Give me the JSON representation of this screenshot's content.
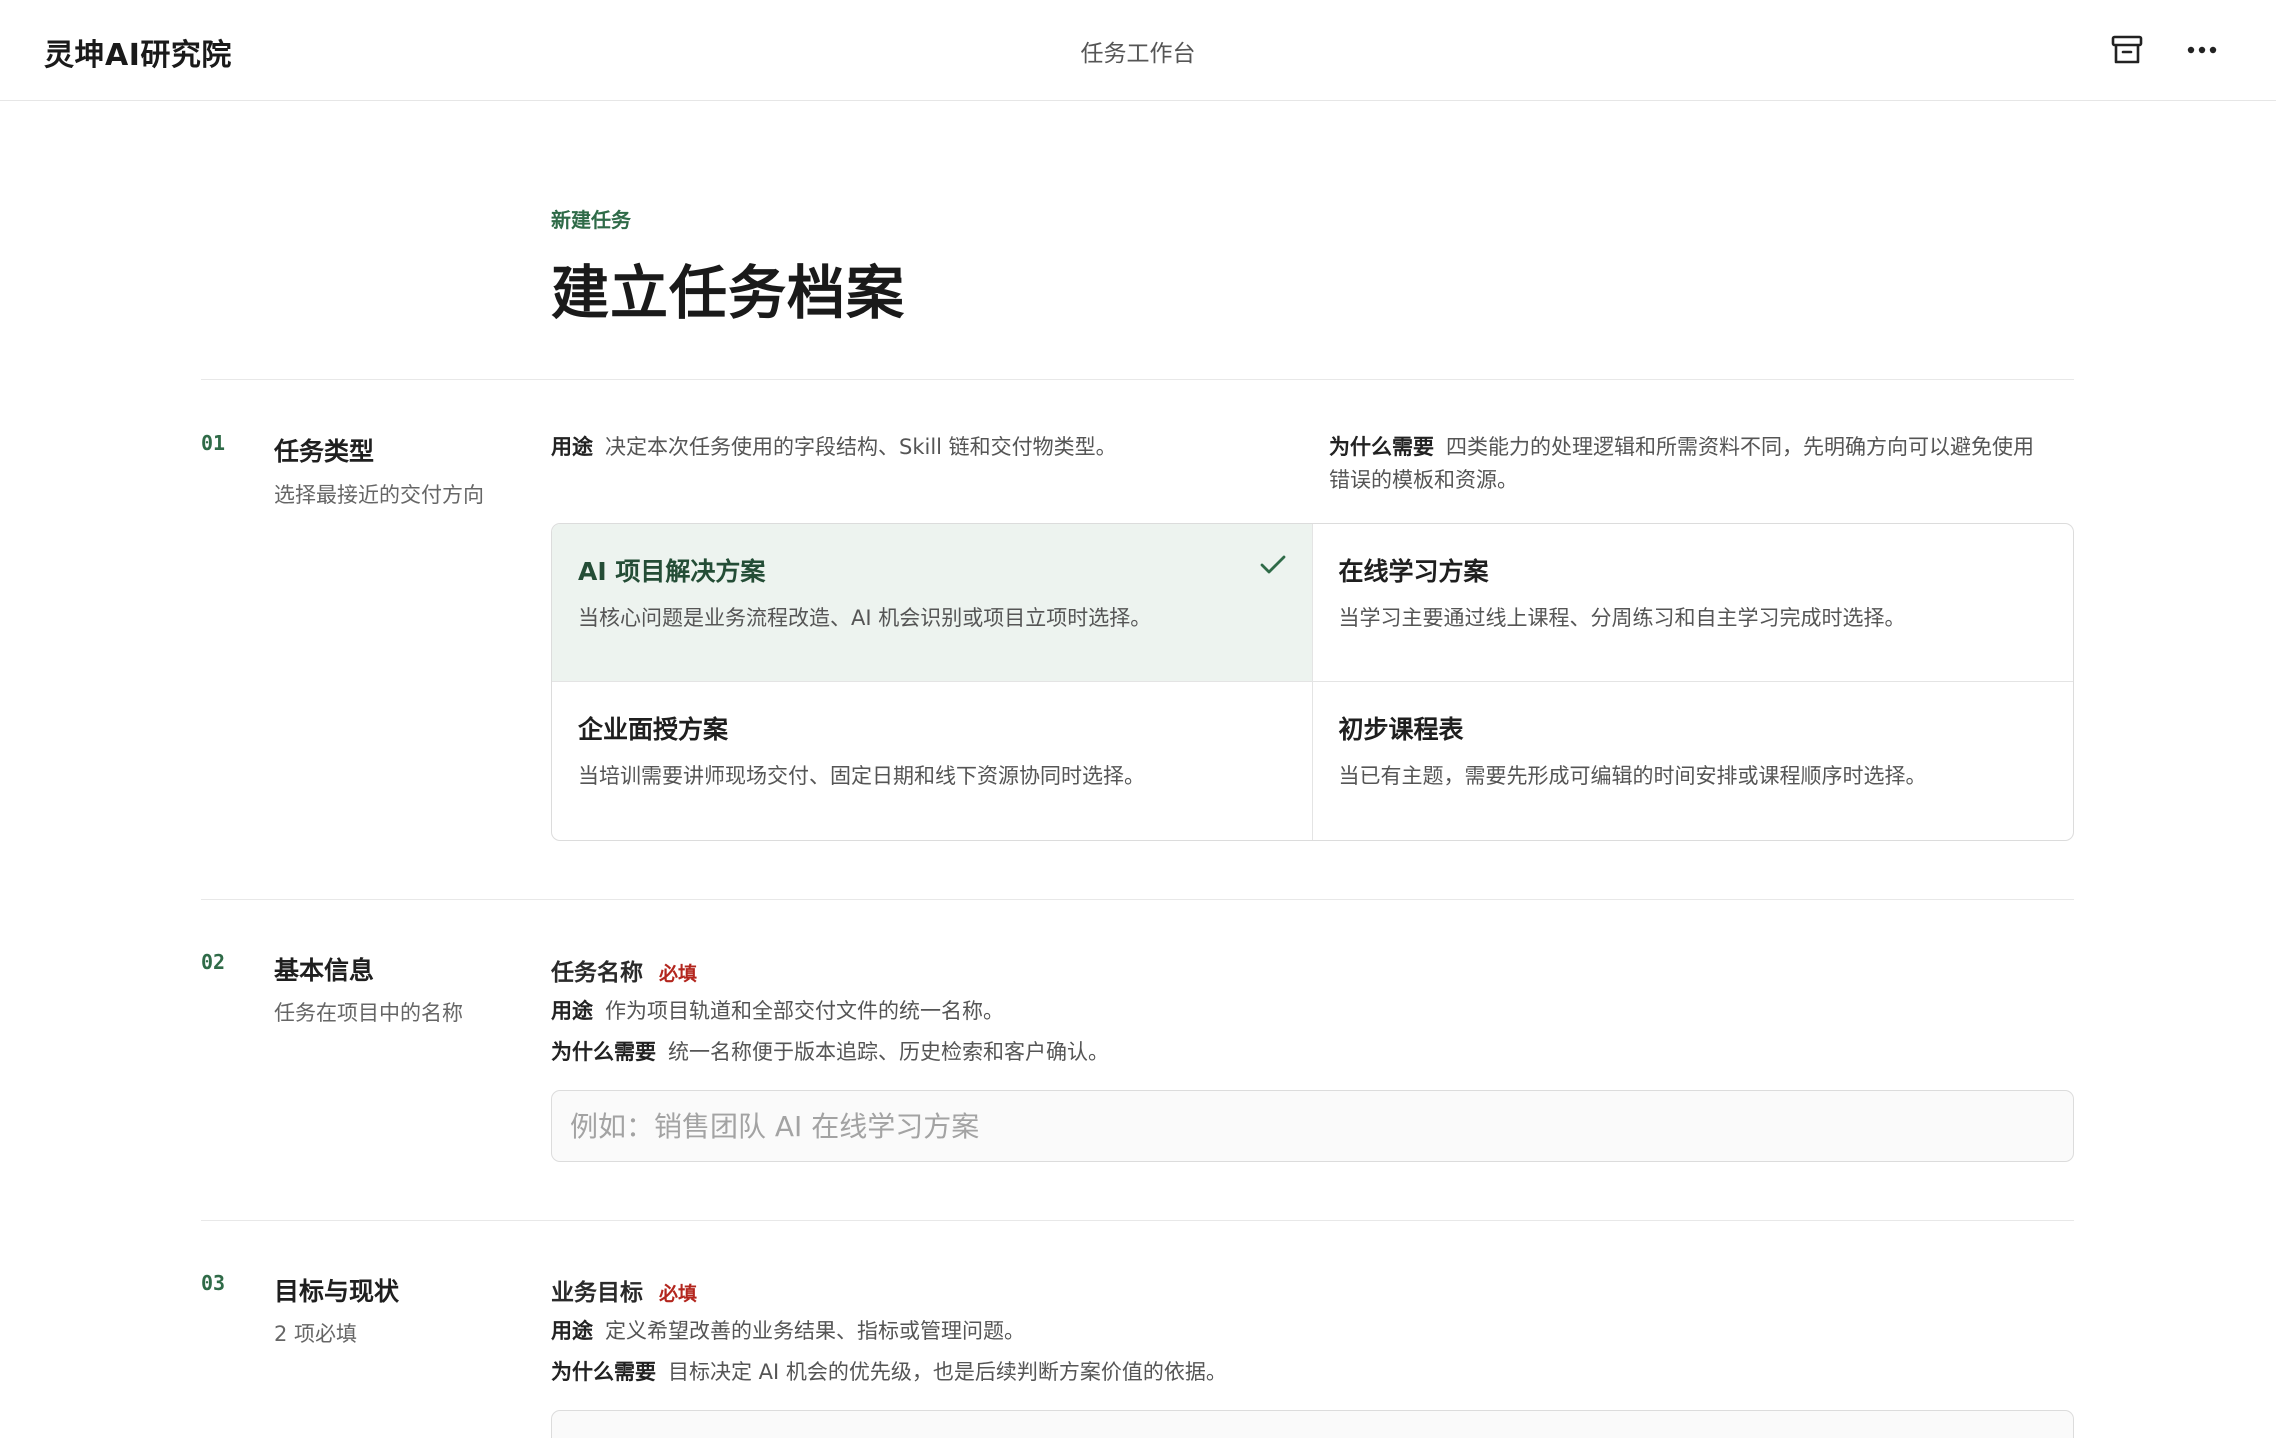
{
  "header": {
    "brand": "灵坤AI研究院",
    "center_title": "任务工作台",
    "icons": [
      "archive-icon",
      "more-icon"
    ]
  },
  "page": {
    "eyebrow": "新建任务",
    "title": "建立任务档案"
  },
  "labels": {
    "purpose": "用途",
    "why": "为什么需要",
    "required": "必填"
  },
  "sections": {
    "s1": {
      "num": "01",
      "title": "任务类型",
      "subtitle": "选择最接近的交付方向",
      "purpose_text": "决定本次任务使用的字段结构、Skill 链和交付物类型。",
      "why_text_1": "四类能力的处理逻辑和所需资料不同，先明确方向可以避免使用",
      "why_text_2": "错误的模板和资源。",
      "options": [
        {
          "title": "AI 项目解决方案",
          "desc": "当核心问题是业务流程改造、AI 机会识别或项目立项时选择。",
          "selected": true
        },
        {
          "title": "在线学习方案",
          "desc": "当学习主要通过线上课程、分周练习和自主学习完成时选择。",
          "selected": false
        },
        {
          "title": "企业面授方案",
          "desc": "当培训需要讲师现场交付、固定日期和线下资源协同时选择。",
          "selected": false
        },
        {
          "title": "初步课程表",
          "desc": "当已有主题，需要先形成可编辑的时间安排或课程顺序时选择。",
          "selected": false
        }
      ]
    },
    "s2": {
      "num": "02",
      "title": "基本信息",
      "subtitle": "任务在项目中的名称",
      "field_label": "任务名称",
      "purpose_text": "作为项目轨道和全部交付文件的统一名称。",
      "why_text": "统一名称便于版本追踪、历史检索和客户确认。",
      "input_value": "",
      "input_placeholder": "例如：销售团队 AI 在线学习方案"
    },
    "s3": {
      "num": "03",
      "title": "目标与现状",
      "subtitle": "2 项必填",
      "field_label": "业务目标",
      "purpose_text": "定义希望改善的业务结果、指标或管理问题。",
      "why_text": "目标决定 AI 机会的优先级，也是后续判断方案价值的依据。"
    }
  }
}
